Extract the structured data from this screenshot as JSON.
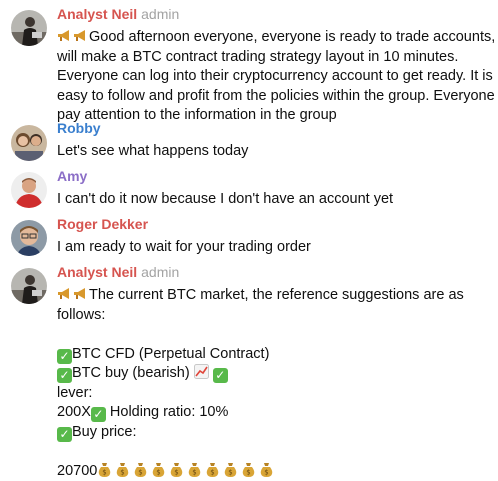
{
  "colors": {
    "name_neil": "#d6544f",
    "name_robby": "#3a7fce",
    "name_amy": "#8b6ec7",
    "name_roger": "#d6544f",
    "role": "#a3a3a3",
    "text": "#0f0f0f"
  },
  "messages": [
    {
      "sender": "Analyst Neil",
      "role": "admin",
      "avatar_icon": "person-with-laptop-avatar",
      "lines": [
        "Good afternoon everyone, everyone is ready to trade accounts, I",
        "will make a BTC contract trading strategy layout in 10 minutes.",
        "Everyone can log into their cryptocurrency account to get ready. It is",
        "easy to follow and profit from the policies within the group. Everyone",
        "pay attention to the information in the group"
      ]
    },
    {
      "sender": "Robby",
      "avatar_icon": "couple-photo-avatar",
      "lines": [
        "Let's see what happens today"
      ]
    },
    {
      "sender": "Amy",
      "avatar_icon": "man-red-shirt-avatar",
      "lines": [
        "I can't do it now because I don't have an account yet"
      ]
    },
    {
      "sender": "Roger Dekker",
      "avatar_icon": "man-glasses-avatar",
      "lines": [
        "I am ready to wait for your trading order"
      ]
    },
    {
      "sender": "Analyst Neil",
      "role": "admin",
      "avatar_icon": "person-with-laptop-avatar",
      "lines": [
        "The current BTC market, the reference suggestions are as",
        "follows:",
        "",
        "BTC CFD (Perpetual Contract)",
        "BTC buy (bearish)",
        "lever:",
        "200X",
        "Holding ratio: 10%",
        "Buy price:",
        "",
        "20700"
      ]
    }
  ],
  "icons": {
    "megaphone": "megaphone-icon",
    "check": "check-mark-button-icon",
    "chart": "chart-increasing-icon",
    "money_bag": "money-bag-icon",
    "check_glyph": "✓"
  }
}
